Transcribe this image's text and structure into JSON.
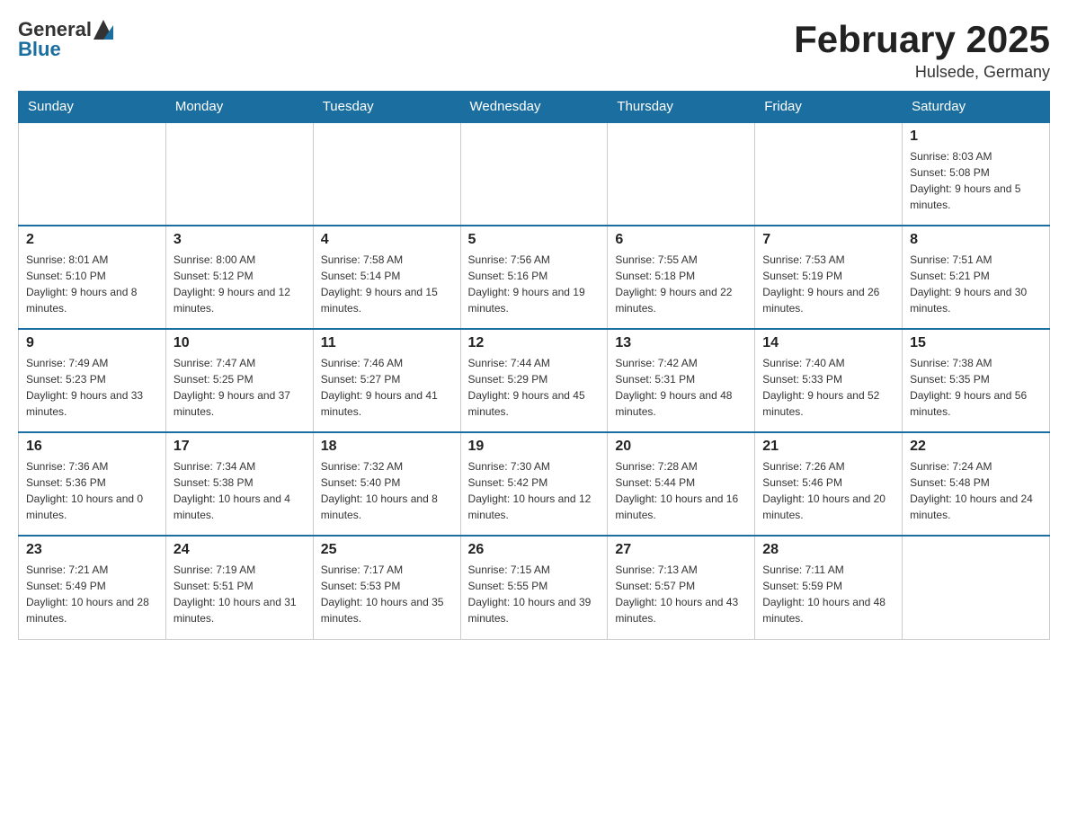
{
  "header": {
    "logo_general": "General",
    "logo_blue": "Blue",
    "month_title": "February 2025",
    "location": "Hulsede, Germany"
  },
  "days_of_week": [
    "Sunday",
    "Monday",
    "Tuesday",
    "Wednesday",
    "Thursday",
    "Friday",
    "Saturday"
  ],
  "weeks": [
    [
      {
        "day": "",
        "info": ""
      },
      {
        "day": "",
        "info": ""
      },
      {
        "day": "",
        "info": ""
      },
      {
        "day": "",
        "info": ""
      },
      {
        "day": "",
        "info": ""
      },
      {
        "day": "",
        "info": ""
      },
      {
        "day": "1",
        "info": "Sunrise: 8:03 AM\nSunset: 5:08 PM\nDaylight: 9 hours and 5 minutes."
      }
    ],
    [
      {
        "day": "2",
        "info": "Sunrise: 8:01 AM\nSunset: 5:10 PM\nDaylight: 9 hours and 8 minutes."
      },
      {
        "day": "3",
        "info": "Sunrise: 8:00 AM\nSunset: 5:12 PM\nDaylight: 9 hours and 12 minutes."
      },
      {
        "day": "4",
        "info": "Sunrise: 7:58 AM\nSunset: 5:14 PM\nDaylight: 9 hours and 15 minutes."
      },
      {
        "day": "5",
        "info": "Sunrise: 7:56 AM\nSunset: 5:16 PM\nDaylight: 9 hours and 19 minutes."
      },
      {
        "day": "6",
        "info": "Sunrise: 7:55 AM\nSunset: 5:18 PM\nDaylight: 9 hours and 22 minutes."
      },
      {
        "day": "7",
        "info": "Sunrise: 7:53 AM\nSunset: 5:19 PM\nDaylight: 9 hours and 26 minutes."
      },
      {
        "day": "8",
        "info": "Sunrise: 7:51 AM\nSunset: 5:21 PM\nDaylight: 9 hours and 30 minutes."
      }
    ],
    [
      {
        "day": "9",
        "info": "Sunrise: 7:49 AM\nSunset: 5:23 PM\nDaylight: 9 hours and 33 minutes."
      },
      {
        "day": "10",
        "info": "Sunrise: 7:47 AM\nSunset: 5:25 PM\nDaylight: 9 hours and 37 minutes."
      },
      {
        "day": "11",
        "info": "Sunrise: 7:46 AM\nSunset: 5:27 PM\nDaylight: 9 hours and 41 minutes."
      },
      {
        "day": "12",
        "info": "Sunrise: 7:44 AM\nSunset: 5:29 PM\nDaylight: 9 hours and 45 minutes."
      },
      {
        "day": "13",
        "info": "Sunrise: 7:42 AM\nSunset: 5:31 PM\nDaylight: 9 hours and 48 minutes."
      },
      {
        "day": "14",
        "info": "Sunrise: 7:40 AM\nSunset: 5:33 PM\nDaylight: 9 hours and 52 minutes."
      },
      {
        "day": "15",
        "info": "Sunrise: 7:38 AM\nSunset: 5:35 PM\nDaylight: 9 hours and 56 minutes."
      }
    ],
    [
      {
        "day": "16",
        "info": "Sunrise: 7:36 AM\nSunset: 5:36 PM\nDaylight: 10 hours and 0 minutes."
      },
      {
        "day": "17",
        "info": "Sunrise: 7:34 AM\nSunset: 5:38 PM\nDaylight: 10 hours and 4 minutes."
      },
      {
        "day": "18",
        "info": "Sunrise: 7:32 AM\nSunset: 5:40 PM\nDaylight: 10 hours and 8 minutes."
      },
      {
        "day": "19",
        "info": "Sunrise: 7:30 AM\nSunset: 5:42 PM\nDaylight: 10 hours and 12 minutes."
      },
      {
        "day": "20",
        "info": "Sunrise: 7:28 AM\nSunset: 5:44 PM\nDaylight: 10 hours and 16 minutes."
      },
      {
        "day": "21",
        "info": "Sunrise: 7:26 AM\nSunset: 5:46 PM\nDaylight: 10 hours and 20 minutes."
      },
      {
        "day": "22",
        "info": "Sunrise: 7:24 AM\nSunset: 5:48 PM\nDaylight: 10 hours and 24 minutes."
      }
    ],
    [
      {
        "day": "23",
        "info": "Sunrise: 7:21 AM\nSunset: 5:49 PM\nDaylight: 10 hours and 28 minutes."
      },
      {
        "day": "24",
        "info": "Sunrise: 7:19 AM\nSunset: 5:51 PM\nDaylight: 10 hours and 31 minutes."
      },
      {
        "day": "25",
        "info": "Sunrise: 7:17 AM\nSunset: 5:53 PM\nDaylight: 10 hours and 35 minutes."
      },
      {
        "day": "26",
        "info": "Sunrise: 7:15 AM\nSunset: 5:55 PM\nDaylight: 10 hours and 39 minutes."
      },
      {
        "day": "27",
        "info": "Sunrise: 7:13 AM\nSunset: 5:57 PM\nDaylight: 10 hours and 43 minutes."
      },
      {
        "day": "28",
        "info": "Sunrise: 7:11 AM\nSunset: 5:59 PM\nDaylight: 10 hours and 48 minutes."
      },
      {
        "day": "",
        "info": ""
      }
    ]
  ]
}
